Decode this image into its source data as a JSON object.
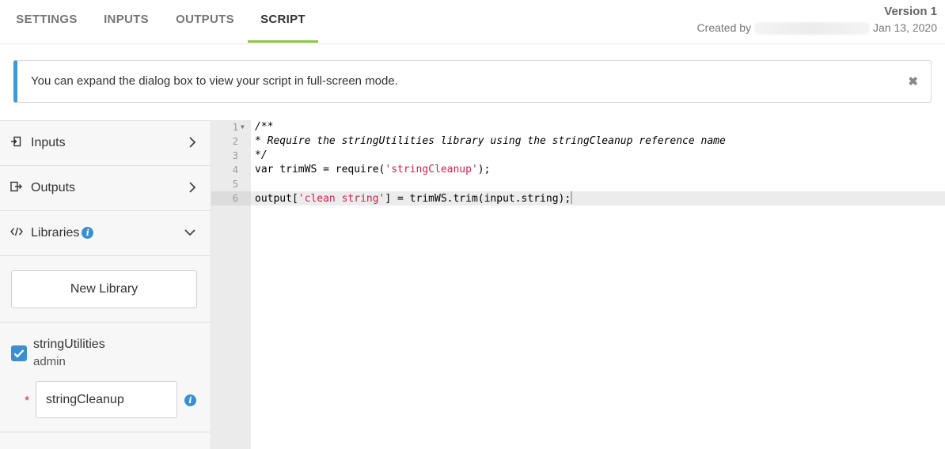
{
  "tabs": [
    {
      "label": "SETTINGS"
    },
    {
      "label": "INPUTS"
    },
    {
      "label": "OUTPUTS"
    },
    {
      "label": "SCRIPT"
    }
  ],
  "active_tab": "SCRIPT",
  "header": {
    "version": "Version 1",
    "created_by_label": "Created by",
    "created_date": "Jan 13, 2020"
  },
  "banner": {
    "message": "You can expand the dialog box to view your script in full-screen mode.",
    "close_icon": "close-icon"
  },
  "sidebar": {
    "inputs_label": "Inputs",
    "outputs_label": "Outputs",
    "libraries_label": "Libraries",
    "new_library_label": "New Library",
    "library": {
      "name": "stringUtilities",
      "owner": "admin",
      "reference_name": "stringCleanup",
      "required_marker": "*"
    }
  },
  "editor": {
    "line_numbers": [
      "1",
      "2",
      "3",
      "4",
      "5",
      "6"
    ],
    "lines": {
      "l1": "/**",
      "l2": "* Require the stringUtilities library using the stringCleanup reference name",
      "l3": "*/",
      "l4_a": "var trimWS = require(",
      "l4_str": "'stringCleanup'",
      "l4_b": ");",
      "l5": "",
      "l6_a": "output[",
      "l6_str": "'clean string'",
      "l6_b": "] = trimWS.trim(input.string);"
    },
    "active_line": 6
  },
  "colors": {
    "accent_tab": "#8cc63f",
    "info_blue": "#3b8fd0",
    "required_red": "#d62d2d",
    "string_red": "#c7254e"
  }
}
